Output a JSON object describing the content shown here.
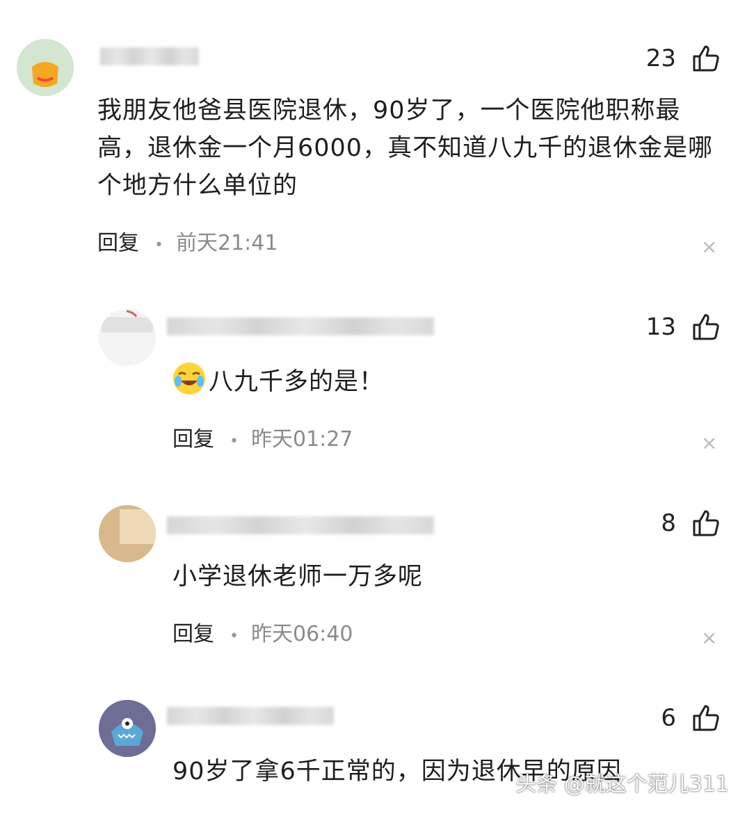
{
  "comments": [
    {
      "likes": "23",
      "text": "我朋友他爸县医院退休，90岁了，一个医院他职称最高，退休金一个月6000，真不知道八九千的退休金是哪个地方什么单位的",
      "reply_label": "回复",
      "time": "前天21:41"
    },
    {
      "likes": "13",
      "text": "八九千多的是！",
      "emoji": "crying-laughing-emoji",
      "reply_label": "回复",
      "time": "昨天01:27"
    },
    {
      "likes": "8",
      "text": "小学退休老师一万多呢",
      "reply_label": "回复",
      "time": "昨天06:40"
    },
    {
      "likes": "6",
      "text": "90岁了拿6千正常的，因为退休早的原因"
    }
  ],
  "watermark": "头条 @就这个范儿311",
  "icons": {
    "like": "thumbs-up-icon",
    "close": "close-icon"
  },
  "colors": {
    "text": "#222222",
    "time": "#8a8a8a",
    "background": "#ffffff"
  }
}
